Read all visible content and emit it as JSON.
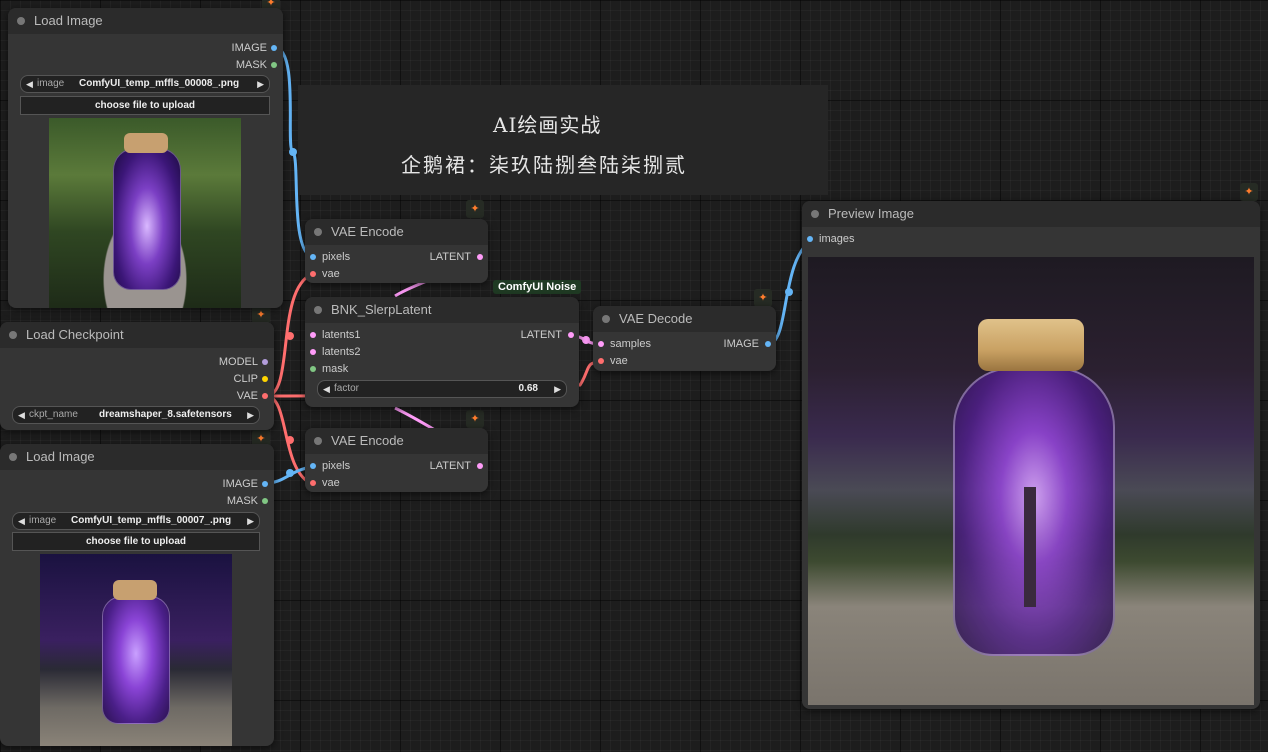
{
  "note": {
    "line1": "AI绘画实战",
    "line2": "企鹅裙：柒玖陆捌叁陆柒捌贰"
  },
  "group_label": "ComfyUI Noise",
  "badge_icon": "fox-icon",
  "colors": {
    "image": "#64b5f6",
    "mask": "#81c784",
    "latent": "#ff9cf9",
    "vae": "#ff6e6e",
    "model": "#b39ddb",
    "clip": "#ffd500"
  },
  "nodes": {
    "load_image_1": {
      "title": "Load Image",
      "outputs": [
        "IMAGE",
        "MASK"
      ],
      "widget_label": "image",
      "widget_value": "ComfyUI_temp_mffls_00008_.png",
      "button": "choose file to upload"
    },
    "load_checkpoint": {
      "title": "Load Checkpoint",
      "outputs": [
        "MODEL",
        "CLIP",
        "VAE"
      ],
      "widget_label": "ckpt_name",
      "widget_value": "dreamshaper_8.safetensors"
    },
    "load_image_2": {
      "title": "Load Image",
      "outputs": [
        "IMAGE",
        "MASK"
      ],
      "widget_label": "image",
      "widget_value": "ComfyUI_temp_mffls_00007_.png",
      "button": "choose file to upload"
    },
    "vae_encode_1": {
      "title": "VAE Encode",
      "inputs": [
        "pixels",
        "vae"
      ],
      "output": "LATENT"
    },
    "slerp": {
      "title": "BNK_SlerpLatent",
      "inputs": [
        "latents1",
        "latents2",
        "mask"
      ],
      "output": "LATENT",
      "widget_label": "factor",
      "widget_value": "0.68"
    },
    "vae_encode_2": {
      "title": "VAE Encode",
      "inputs": [
        "pixels",
        "vae"
      ],
      "output": "LATENT"
    },
    "vae_decode": {
      "title": "VAE Decode",
      "inputs": [
        "samples",
        "vae"
      ],
      "output": "IMAGE"
    },
    "preview": {
      "title": "Preview Image",
      "input": "images"
    }
  }
}
